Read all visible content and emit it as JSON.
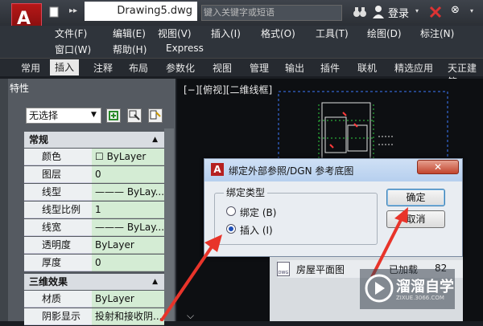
{
  "titlebar": {
    "document_title": "Drawing5.dwg",
    "search_placeholder": "键入关键字或短语",
    "login_label": "登录"
  },
  "menu": {
    "row1": [
      "文件(F)",
      "编辑(E)",
      "视图(V)",
      "插入(I)",
      "格式(O)",
      "工具(T)",
      "绘图(D)",
      "标注(N)"
    ],
    "row2": [
      "窗口(W)",
      "帮助(H)",
      "Express"
    ]
  },
  "ribbon": {
    "tabs": [
      "常用",
      "插入",
      "注释",
      "布局",
      "参数化",
      "视图",
      "管理",
      "输出",
      "插件",
      "联机",
      "精选应用",
      "天正建筑"
    ],
    "active_tab": "插入"
  },
  "properties": {
    "title": "特性",
    "selection": "无选择",
    "general": {
      "header": "常规",
      "rows": [
        {
          "name": "颜色",
          "value": "☐ ByLayer"
        },
        {
          "name": "图层",
          "value": "0"
        },
        {
          "name": "线型",
          "value": "——— ByLay..."
        },
        {
          "name": "线型比例",
          "value": "1"
        },
        {
          "name": "线宽",
          "value": "——— ByLay..."
        },
        {
          "name": "透明度",
          "value": "ByLayer"
        },
        {
          "name": "厚度",
          "value": "0"
        }
      ]
    },
    "effects": {
      "header": "三维效果",
      "rows": [
        {
          "name": "材质",
          "value": "ByLayer"
        },
        {
          "name": "阴影显示",
          "value": "投射和接收阴..."
        }
      ]
    }
  },
  "canvas": {
    "view_label": "[−][俯视][二维线框]"
  },
  "dialog": {
    "title": "绑定外部参照/DGN 参考底图",
    "close_glyph": "✕",
    "group_label": "绑定类型",
    "options": [
      {
        "label": "绑定 (B)",
        "selected": false
      },
      {
        "label": "插入 (I)",
        "selected": true
      }
    ],
    "ok_label": "确定",
    "cancel_label": "取消"
  },
  "xref_list": {
    "name": "房屋平面图",
    "status": "已加载",
    "size": "82"
  },
  "watermark": {
    "name": "溜溜自学",
    "url": "ZIXUE.3066.COM"
  },
  "colors": {
    "arrow": "#e8342a",
    "autocad_red": "#b61818",
    "dialog_title": "#c5d9f1",
    "value_cell": "#d4ecd4"
  },
  "icons": [
    "autocad-logo-icon",
    "new-file-icon",
    "binoculars-icon",
    "user-icon",
    "exchange-icon",
    "dwg-file-icon",
    "quick-select-icon",
    "select-objects-icon",
    "toggle-pickadd-icon"
  ]
}
